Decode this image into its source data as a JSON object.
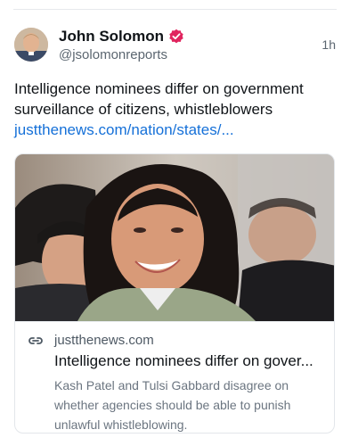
{
  "author": {
    "display_name": "John Solomon",
    "handle": "@jsolomonreports",
    "verified": true
  },
  "post": {
    "timestamp": "1h",
    "text": "Intelligence nominees differ on government surveillance of citizens, whistleblowers",
    "link_text": "justthenews.com/nation/states/..."
  },
  "link_card": {
    "domain": "justthenews.com",
    "title": "Intelligence nominees differ on gover...",
    "description": "Kash Patel and Tulsi Gabbard disagree on whether agencies should be able to punish unlawful whistleblowing."
  },
  "colors": {
    "link": "#1570d8",
    "verified_badge": "#e0245e",
    "secondary_text": "#5b6670"
  },
  "icons": {
    "verified": "verified-badge-icon",
    "card_link": "link-chain-icon"
  }
}
